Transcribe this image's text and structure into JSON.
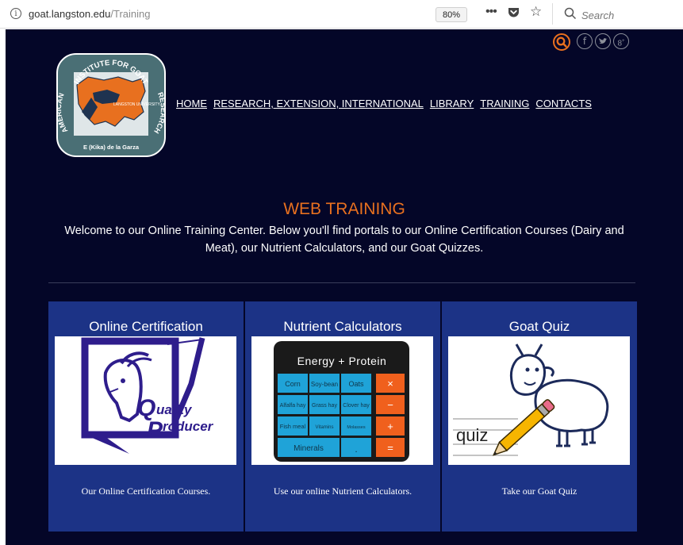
{
  "browser": {
    "url_host": "goat.langston.edu",
    "url_path": "/Training",
    "zoom": "80%",
    "search_placeholder": "Search"
  },
  "logo": {
    "top_text": "INSTITUTE FOR GOAT",
    "left_text": "AMERICAN",
    "right_text": "RESEARCH",
    "bottom_text": "E (Kika) de la Garza",
    "map_text": "LANGSTON UNIVERSITY"
  },
  "nav": {
    "items": [
      {
        "label": "HOME"
      },
      {
        "label": "RESEARCH, EXTENSION, INTERNATIONAL"
      },
      {
        "label": "LIBRARY"
      },
      {
        "label": "TRAINING"
      },
      {
        "label": "CONTACTS"
      }
    ]
  },
  "main": {
    "heading": "WEB TRAINING",
    "welcome": "Welcome to our Online Training Center. Below you'll find portals to our Online Certification Courses (Dairy and Meat), our Nutrient Calculators, and our Goat Quizzes."
  },
  "cards": [
    {
      "title": "Online Certification",
      "caption": "Our Online Certification Courses.",
      "image_text": [
        "uality",
        "roducer",
        "Q",
        "P"
      ]
    },
    {
      "title": "Nutrient Calculators",
      "caption": "Use our online Nutrient Calculators.",
      "calc": {
        "header": "Energy + Protein",
        "cells": [
          "Corn",
          "Soy-bean",
          "Oats",
          "Alfalfa hay",
          "Grass hay",
          "Clover hay",
          "Fish meal",
          "Vitamins",
          "Molasses",
          "Minerals",
          "."
        ],
        "ops": [
          "×",
          "−",
          "+",
          "="
        ]
      }
    },
    {
      "title": "Goat Quiz",
      "caption": "Take our Goat Quiz",
      "image_text": "quiz"
    }
  ],
  "colors": {
    "page_bg": "#040628",
    "card_bg": "#1c3386",
    "accent": "#e8701f",
    "calc_blue": "#1fa3d8",
    "calc_orange": "#f0601d"
  }
}
